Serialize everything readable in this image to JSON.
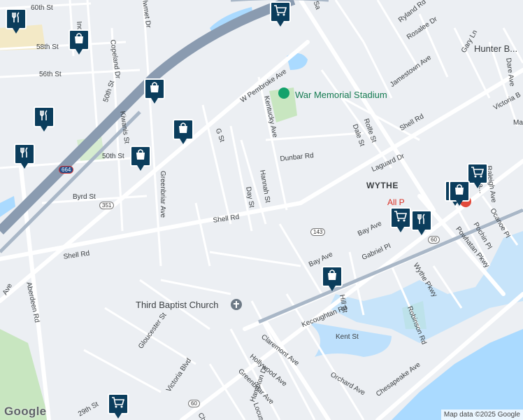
{
  "map": {
    "neighborhood": "WYTHE",
    "area_label": "Hunter B...",
    "streets": {
      "st60": "60th St",
      "st58": "58th St",
      "st56": "56th St",
      "st50": "50th St",
      "st50b": "50th St",
      "st29": "29th St",
      "pembroke": "W Pembroke Ave",
      "shell1": "Shell Rd",
      "shell2": "Shell Rd",
      "shell3": "Shell Rd",
      "byrd": "Byrd St",
      "aberdeen": "Aberdeen Rd",
      "greenbriar": "Greenbriar Ave",
      "greenbriar2": "Greenbriar Ave",
      "kiwanis": "Kiwanis St",
      "copeland": "Copeland Dr",
      "gst": "G St",
      "dayst": "Day St",
      "hannah": "Hannah St",
      "dunbar": "Dunbar Rd",
      "kentucky": "Kentucky Ave",
      "dale": "Dale St",
      "rolfe": "Rolfe St",
      "laguard": "Laguard Dr",
      "victoria1": "Victoria B",
      "victoria2": "Victoria Blvd",
      "bay1": "Bay Ave",
      "bay2": "Bay Ave",
      "gabriel": "Gabriel Pl",
      "wythepkwy": "Wythe Pkwy",
      "powhatan": "Powhatan Pkwy",
      "kecoughtan": "Kecoughtan Rd",
      "hill": "Hill St",
      "kent": "Kent St",
      "robinson": "Robinson Rd",
      "claremont": "Claremont Ave",
      "hollywood": "Hollywood Ave",
      "orchard": "Orchard Ave",
      "chesapeake": "Chesapeake Ave",
      "gloucester": "Gloucester St",
      "jamestown": "Jamestown Ave",
      "rosalee": "Rosalee Dr",
      "ryland": "Ryland Rd",
      "gary": "Gary Ln",
      "dare": "Dare Ave",
      "raleigh": "Raleigh Ave",
      "little": "Little Fa...",
      "ocanoe": "Ocanoe Pl",
      "pochin": "Pochin Pl",
      "hampton": "Hampton Dr",
      "locust": "Locust",
      "ave_left": "Ave",
      "ind": "Ind",
      "lawmet": "lwmet Dr",
      "sa": "Sa",
      "ma": "Ma",
      "ches_small": "Che",
      "allp": "All P"
    },
    "shields": {
      "i664": "664",
      "r351": "351",
      "r143": "143",
      "us60a": "60",
      "us60b": "60"
    },
    "pois": {
      "stadium": "War Memorial Stadium",
      "church": "Third Baptist Church"
    },
    "colors": {
      "highway": "#8a9bb0",
      "main_road": "#ffffff",
      "water": "#aadaff",
      "park": "#c8e6c0",
      "pin": "#0b3d5c"
    },
    "pins": [
      {
        "type": "restaurant-icon"
      },
      {
        "type": "shopping-bag-icon"
      },
      {
        "type": "shopping-cart-icon"
      },
      {
        "type": "shopping-bag-icon"
      },
      {
        "type": "restaurant-icon"
      },
      {
        "type": "shopping-bag-icon"
      },
      {
        "type": "restaurant-icon"
      },
      {
        "type": "shopping-bag-icon"
      },
      {
        "type": "shopping-cart-icon"
      },
      {
        "type": "shopping-bag-icon"
      },
      {
        "type": "shopping-cart-icon"
      },
      {
        "type": "restaurant-icon"
      },
      {
        "type": "shopping-bag-icon"
      },
      {
        "type": "shopping-bag-icon"
      },
      {
        "type": "shopping-cart-icon"
      }
    ],
    "logo": "Google",
    "attribution": "Map data ©2025 Google"
  }
}
